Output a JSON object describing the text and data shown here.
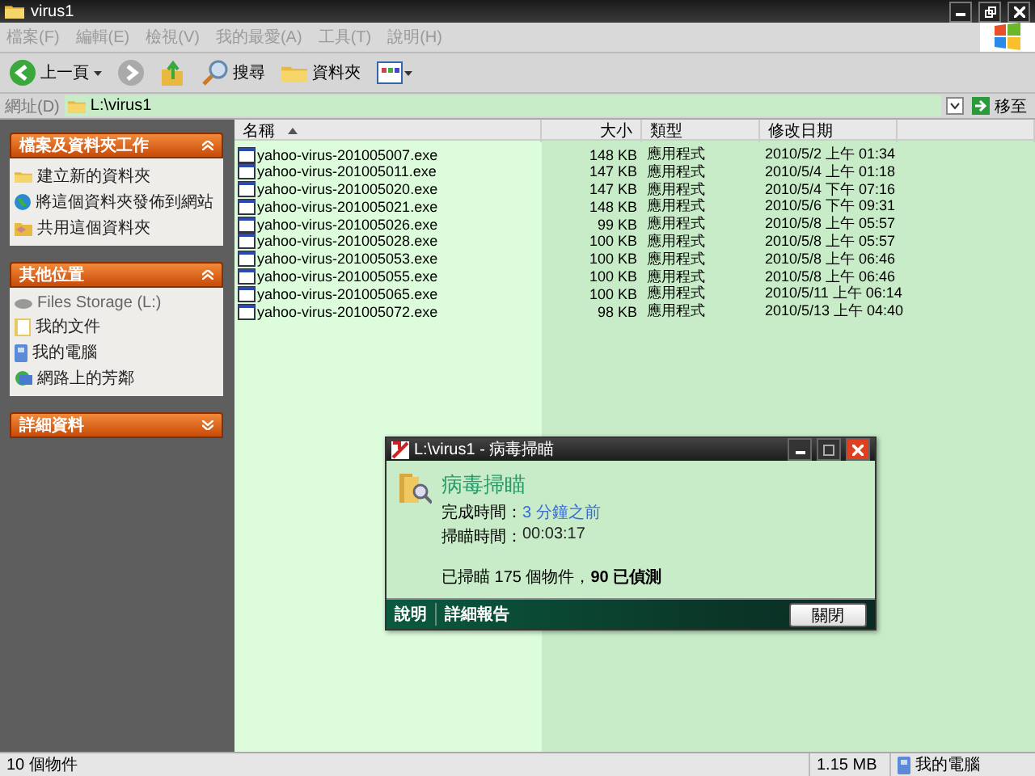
{
  "window": {
    "title": "virus1"
  },
  "menu": [
    "檔案(F)",
    "編輯(E)",
    "檢視(V)",
    "我的最愛(A)",
    "工具(T)",
    "說明(H)"
  ],
  "toolbar": {
    "back": "上一頁",
    "search": "搜尋",
    "folders": "資料夾"
  },
  "address": {
    "label": "網址(D)",
    "value": "L:\\virus1",
    "go": "移至"
  },
  "sidebar": [
    {
      "title": "檔案及資料夾工作",
      "expanded": true,
      "items": [
        "建立新的資料夾",
        "將這個資料夾發佈到網站",
        "共用這個資料夾"
      ]
    },
    {
      "title": "其他位置",
      "expanded": true,
      "items": [
        "Files Storage (L:)",
        "我的文件",
        "我的電腦",
        "網路上的芳鄰"
      ]
    },
    {
      "title": "詳細資料",
      "expanded": false
    }
  ],
  "table": {
    "columns": [
      "名稱",
      "大小",
      "類型",
      "修改日期"
    ],
    "rows": [
      {
        "name": "yahoo-virus-201005007.exe",
        "size": "148 KB",
        "type": "應用程式",
        "modified": "2010/5/2 上午 01:34"
      },
      {
        "name": "yahoo-virus-201005011.exe",
        "size": "147 KB",
        "type": "應用程式",
        "modified": "2010/5/4 上午 01:18"
      },
      {
        "name": "yahoo-virus-201005020.exe",
        "size": "147 KB",
        "type": "應用程式",
        "modified": "2010/5/4 下午 07:16"
      },
      {
        "name": "yahoo-virus-201005021.exe",
        "size": "148 KB",
        "type": "應用程式",
        "modified": "2010/5/6 下午 09:31"
      },
      {
        "name": "yahoo-virus-201005026.exe",
        "size": "99 KB",
        "type": "應用程式",
        "modified": "2010/5/8 上午 05:57"
      },
      {
        "name": "yahoo-virus-201005028.exe",
        "size": "100 KB",
        "type": "應用程式",
        "modified": "2010/5/8 上午 05:57"
      },
      {
        "name": "yahoo-virus-201005053.exe",
        "size": "100 KB",
        "type": "應用程式",
        "modified": "2010/5/8 上午 06:46"
      },
      {
        "name": "yahoo-virus-201005055.exe",
        "size": "100 KB",
        "type": "應用程式",
        "modified": "2010/5/8 上午 06:46"
      },
      {
        "name": "yahoo-virus-201005065.exe",
        "size": "100 KB",
        "type": "應用程式",
        "modified": "2010/5/11 上午 06:14"
      },
      {
        "name": "yahoo-virus-201005072.exe",
        "size": "98 KB",
        "type": "應用程式",
        "modified": "2010/5/13 上午 04:40"
      }
    ]
  },
  "dialog": {
    "title": "L:\\virus1 - 病毒掃瞄",
    "heading": "病毒掃瞄",
    "fields": [
      {
        "label": "完成時間：",
        "value": "3 分鐘之前",
        "kind": "link"
      },
      {
        "label": "掃瞄時間：",
        "value": "00:03:17",
        "kind": "plain"
      }
    ],
    "summary": "已掃瞄 175 個物件，**90 已偵測**",
    "links": [
      "說明",
      "詳細報告"
    ],
    "button": "關閉"
  },
  "status_bar": {
    "count": "10 個物件",
    "size": "1.15 MB",
    "location": "我的電腦"
  }
}
